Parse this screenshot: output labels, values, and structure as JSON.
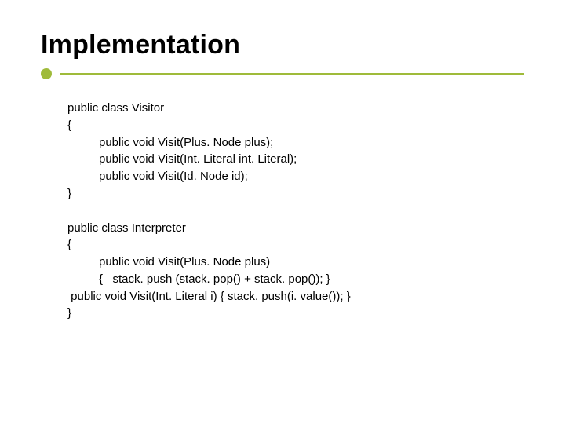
{
  "title": "Implementation",
  "visitor": {
    "l1": "public class Visitor",
    "l2": "{",
    "l3": "public void Visit(Plus. Node plus);",
    "l4": "public void Visit(Int. Literal int. Literal);",
    "l5": "public void Visit(Id. Node id);",
    "l6": "}"
  },
  "interpreter": {
    "l1": "public class Interpreter",
    "l2": "{",
    "l3": "public void Visit(Plus. Node plus)",
    "l4": "{   stack. push (stack. pop() + stack. pop()); }",
    "l5": " public void Visit(Int. Literal i) { stack. push(i. value()); }",
    "l6": "}"
  }
}
